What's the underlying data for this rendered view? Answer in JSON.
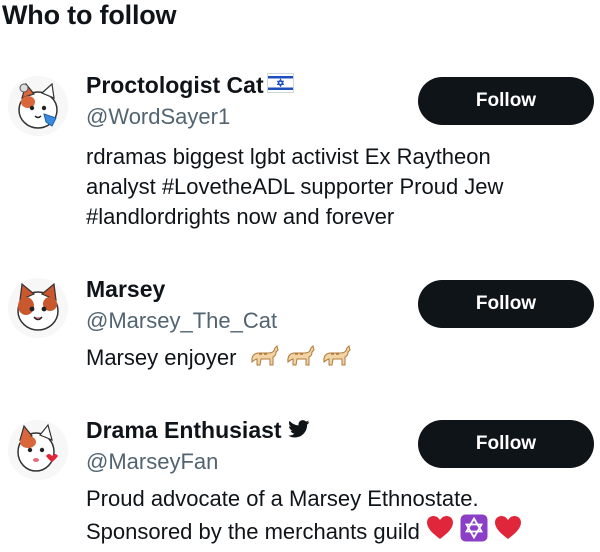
{
  "heading": "Who to follow",
  "accounts": [
    {
      "name": "Proctologist Cat",
      "badge_icon": "israel-flag-icon",
      "handle": "@WordSayer1",
      "bio_lines": [
        "rdramas biggest lgbt activist Ex Raytheon",
        "analyst #LovetheADL supporter Proud Jew",
        "#landlordrights now and forever"
      ],
      "follow_label": "Follow"
    },
    {
      "name": "Marsey",
      "handle": "@Marsey_The_Cat",
      "bio": "Marsey enjoyer",
      "bio_icons": [
        "cat-emoji-icon",
        "cat-emoji-icon",
        "cat-emoji-icon"
      ],
      "follow_label": "Follow"
    },
    {
      "name": "Drama Enthusiast",
      "badge_icon": "twitter-bird-icon",
      "handle": "@MarseyFan",
      "bio_lines": [
        "Proud advocate of a Marsey Ethnostate.",
        "Sponsored by the merchants guild"
      ],
      "bio_icons": [
        "red-heart-icon",
        "star-of-david-icon",
        "red-heart-icon"
      ],
      "follow_label": "Follow"
    }
  ],
  "colors": {
    "text": "#0f1419",
    "secondary_text": "#536471",
    "button_bg": "#0f1419",
    "button_text": "#ffffff",
    "flag_blue": "#1f4fbf",
    "heart_red": "#e0263a",
    "star_bg": "#8b3fc7"
  }
}
